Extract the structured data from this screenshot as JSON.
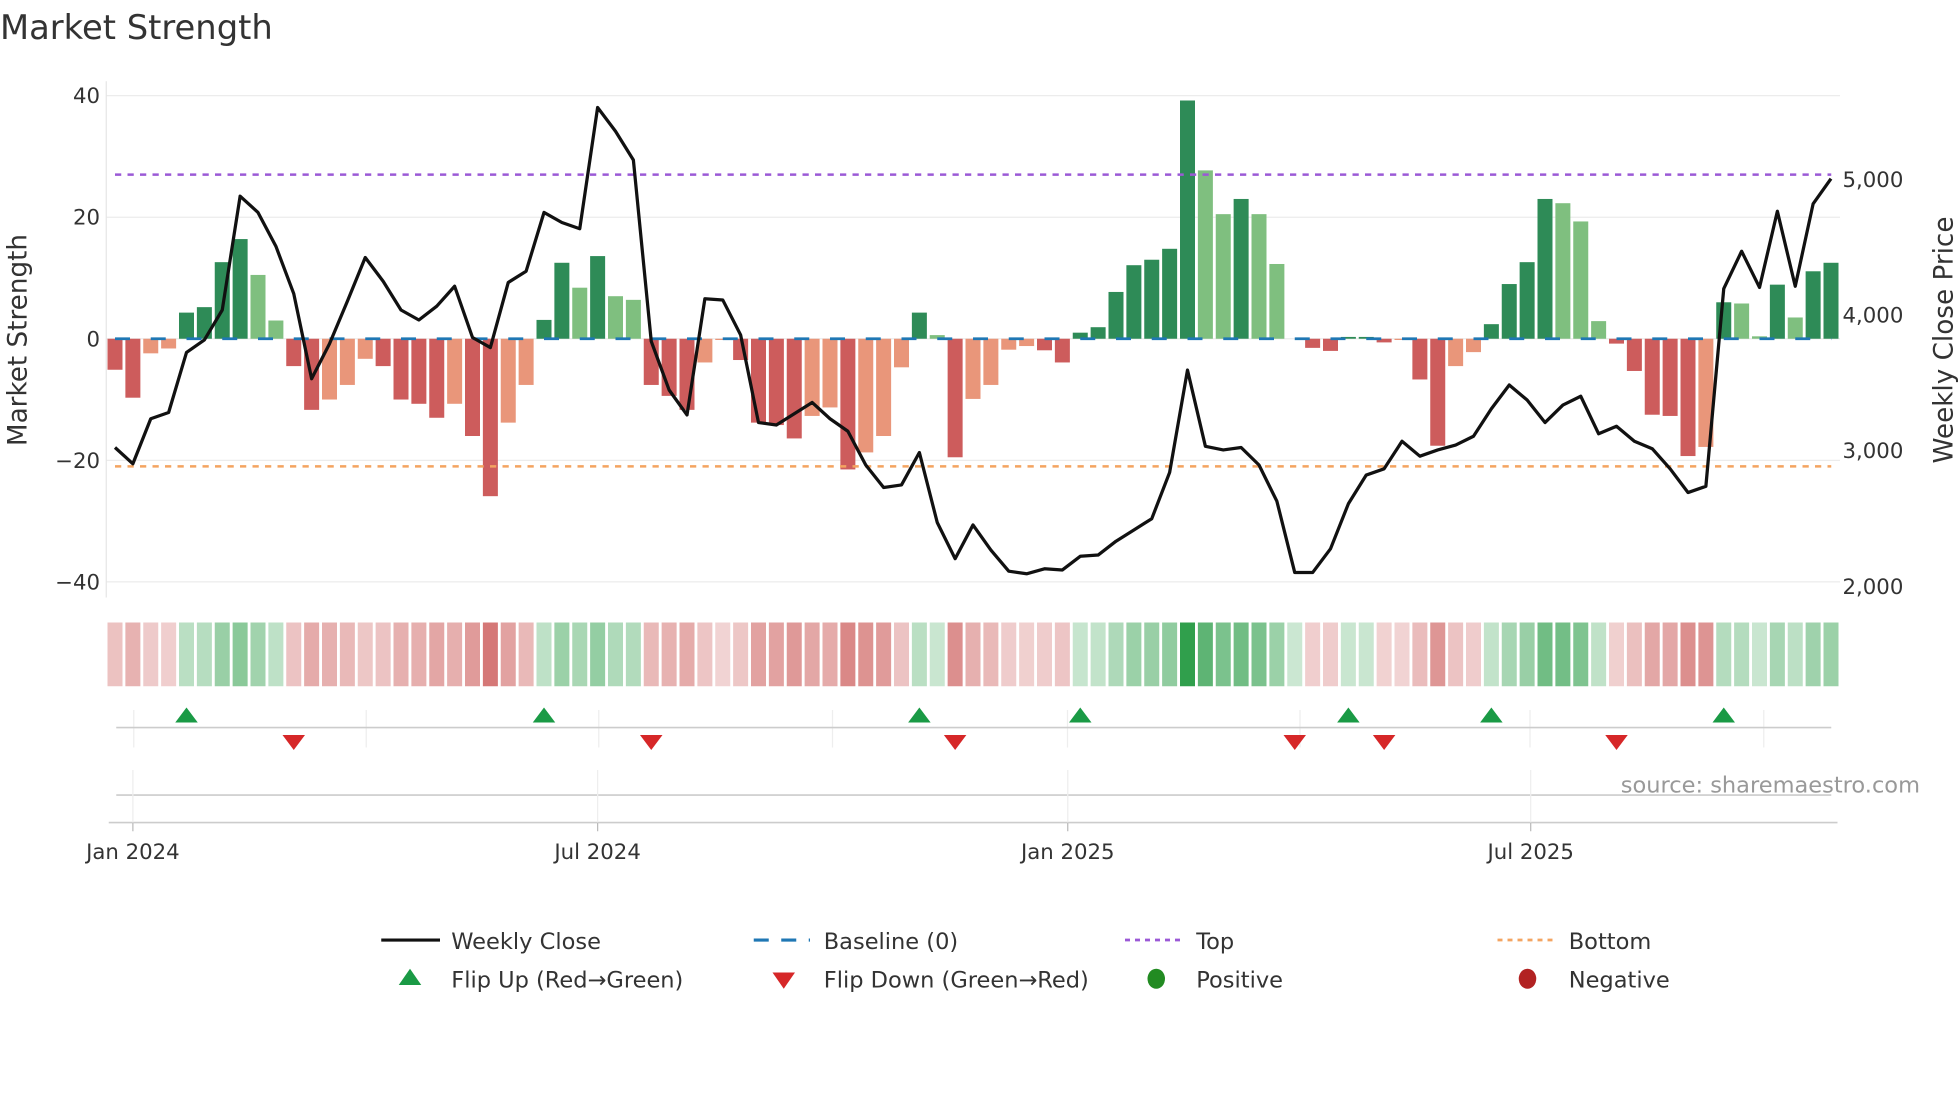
{
  "title": "Market Strength",
  "source": "source: sharemaestro.com",
  "colors": {
    "strong_pos": "#2e8b57",
    "weak_pos": "#7fbf7f",
    "strong_neg": "#cd5c5c",
    "weak_neg": "#e9967a",
    "close": "#111111",
    "baseline": "#1f77b4",
    "top": "#9b59d6",
    "bottom": "#f4a460",
    "flip_up": "#1a9a45",
    "flip_down": "#d62728",
    "positive": "#228b22",
    "negative": "#b22222"
  },
  "chart_data": {
    "type": "bar",
    "title": "Market Strength",
    "ylabel": "Market Strength",
    "y2label": "Weekly Close Price",
    "ylim": [
      -42,
      42
    ],
    "y2lim": [
      1980,
      5630
    ],
    "yticks": [
      {
        "v": 40,
        "label": "40"
      },
      {
        "v": 20,
        "label": "20"
      },
      {
        "v": 0,
        "label": "0"
      },
      {
        "v": -20,
        "label": "−20"
      },
      {
        "v": -40,
        "label": "−40"
      }
    ],
    "y2ticks": [
      {
        "v": 5000,
        "label": "5,000"
      },
      {
        "v": 4000,
        "label": "4,000"
      },
      {
        "v": 3000,
        "label": "3,000"
      },
      {
        "v": 2000,
        "label": "2,000"
      }
    ],
    "xticks": [
      {
        "week": 1,
        "label": "Jan 2024"
      },
      {
        "week": 27,
        "label": "Jul 2024"
      },
      {
        "week": 53.3,
        "label": "Jan 2025"
      },
      {
        "week": 79.2,
        "label": "Jul 2025"
      }
    ],
    "x_start": "2023-12-25",
    "x_interval": "weekly",
    "top_level": 27,
    "bottom_level": -21,
    "strength": [
      -5.1,
      -9.7,
      -2.4,
      -1.6,
      4.3,
      5.2,
      12.6,
      16.4,
      10.5,
      3.0,
      -4.5,
      -11.7,
      -10.0,
      -7.6,
      -3.3,
      -4.5,
      -10.0,
      -10.7,
      -13.0,
      -10.7,
      -16.0,
      -25.9,
      -13.8,
      -7.6,
      3.1,
      12.5,
      8.4,
      13.6,
      7.0,
      6.4,
      -7.6,
      -9.4,
      -11.7,
      -3.9,
      -0.2,
      -3.5,
      -13.8,
      -14.2,
      -16.4,
      -12.7,
      -11.3,
      -21.5,
      -18.7,
      -16.0,
      -4.7,
      4.3,
      0.6,
      -19.5,
      -9.9,
      -7.6,
      -1.8,
      -1.2,
      -1.9,
      -3.9,
      1.0,
      1.9,
      7.7,
      12.1,
      13.0,
      14.8,
      39.2,
      27.7,
      20.5,
      23.0,
      20.5,
      12.3,
      0,
      -1.5,
      -2.0,
      0.3,
      0.3,
      -0.6,
      -0.1,
      -6.7,
      -17.6,
      -4.5,
      -2.2,
      2.4,
      9.0,
      12.6,
      23.0,
      22.3,
      19.3,
      2.9,
      -0.8,
      -5.3,
      -12.5,
      -12.7,
      -19.3,
      -17.8,
      6.0,
      5.8,
      0.4,
      8.9,
      3.5,
      11.1,
      12.5
    ],
    "strength_class": "RRrrGGGGggRRrrrRRRRrRRrrGGgGggRRRrrRRRRrrRrrrGgRrrrrRRGGGGGGGggGgg-RRGGRrRRrrGGGGgggRRRRRrGggGgGG",
    "weekly_close": [
      3023,
      2903,
      3235,
      3281,
      3724,
      3816,
      4037,
      4876,
      4756,
      4507,
      4157,
      3530,
      3788,
      4101,
      4424,
      4249,
      4037,
      3963,
      4065,
      4212,
      3834,
      3760,
      4240,
      4323,
      4756,
      4682,
      4636,
      5530,
      5355,
      5143,
      3806,
      3447,
      3263,
      4120,
      4111,
      3853,
      3207,
      3189,
      3272,
      3355,
      3235,
      3143,
      2894,
      2728,
      2747,
      2986,
      2470,
      2203,
      2452,
      2267,
      2111,
      2092,
      2129,
      2120,
      2221,
      2230,
      2332,
      2415,
      2498,
      2839,
      3594,
      3032,
      3005,
      3023,
      2894,
      2627,
      2101,
      2101,
      2276,
      2608,
      2820,
      2866,
      3069,
      2959,
      3005,
      3041,
      3106,
      3309,
      3484,
      3373,
      3207,
      3336,
      3401,
      3124,
      3180,
      3069,
      3014,
      2866,
      2691,
      2737,
      4194,
      4470,
      4203,
      4765,
      4212,
      4820,
      5005
    ],
    "flip_up_weeks": [
      5,
      25,
      46,
      55,
      70,
      78,
      91
    ],
    "flip_down_weeks": [
      11,
      31,
      48,
      67,
      72,
      85
    ],
    "legend": {
      "placement": "bottom",
      "items": [
        {
          "key": "close",
          "label": "Weekly Close"
        },
        {
          "key": "baseline",
          "label": "Baseline (0)"
        },
        {
          "key": "top",
          "label": "Top"
        },
        {
          "key": "bottom",
          "label": "Bottom"
        },
        {
          "key": "flip_up",
          "label": "Flip Up (Red→Green)"
        },
        {
          "key": "flip_down",
          "label": "Flip Down (Green→Red)"
        },
        {
          "key": "positive",
          "label": "Positive"
        },
        {
          "key": "negative",
          "label": "Negative"
        }
      ]
    }
  }
}
